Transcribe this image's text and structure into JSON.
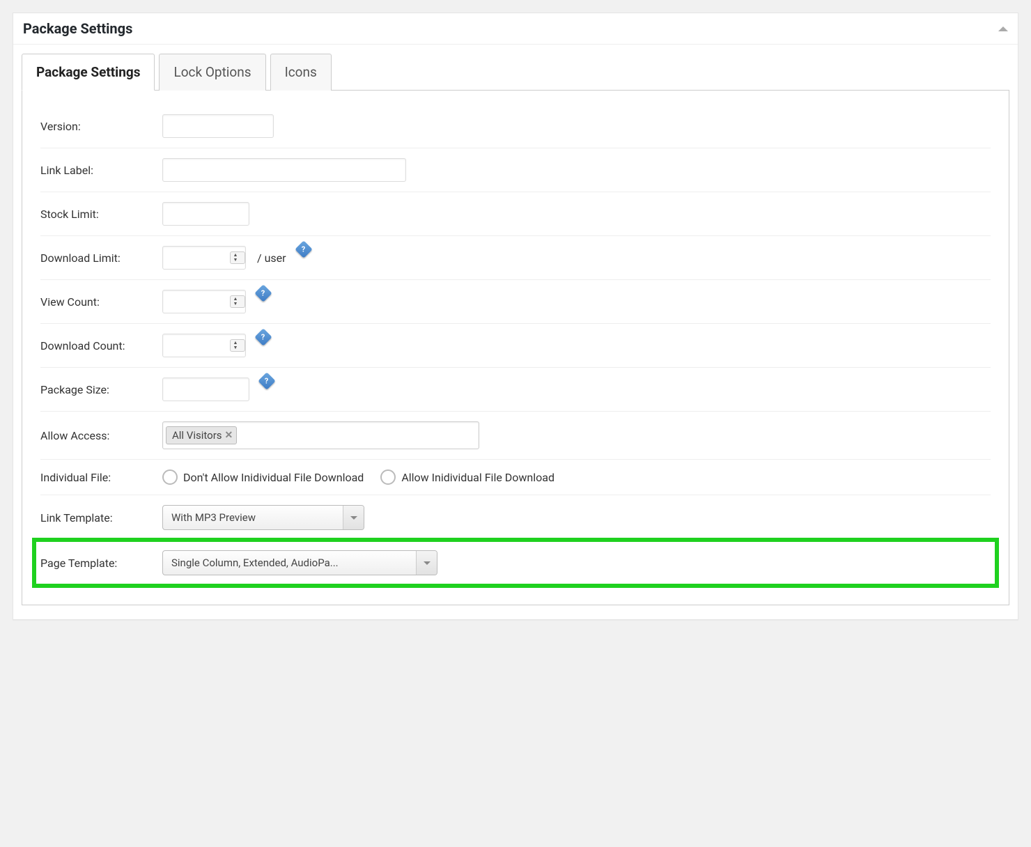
{
  "panel": {
    "title": "Package Settings"
  },
  "tabs": {
    "package_settings": "Package Settings",
    "lock_options": "Lock Options",
    "icons": "Icons"
  },
  "fields": {
    "version": {
      "label": "Version:"
    },
    "link_label": {
      "label": "Link Label:"
    },
    "stock_limit": {
      "label": "Stock Limit:"
    },
    "download_limit": {
      "label": "Download Limit:",
      "suffix": "/ user"
    },
    "view_count": {
      "label": "View Count:"
    },
    "download_count": {
      "label": "Download Count:"
    },
    "package_size": {
      "label": "Package Size:"
    },
    "allow_access": {
      "label": "Allow Access:",
      "tag": "All Visitors"
    },
    "individual_file": {
      "label": "Individual File:",
      "option_no": "Don't Allow Inidividual File Download",
      "option_yes": "Allow Inidividual File Download"
    },
    "link_template": {
      "label": "Link Template:",
      "value": "With MP3 Preview"
    },
    "page_template": {
      "label": "Page Template:",
      "value": "Single Column, Extended, AudioPa..."
    }
  }
}
